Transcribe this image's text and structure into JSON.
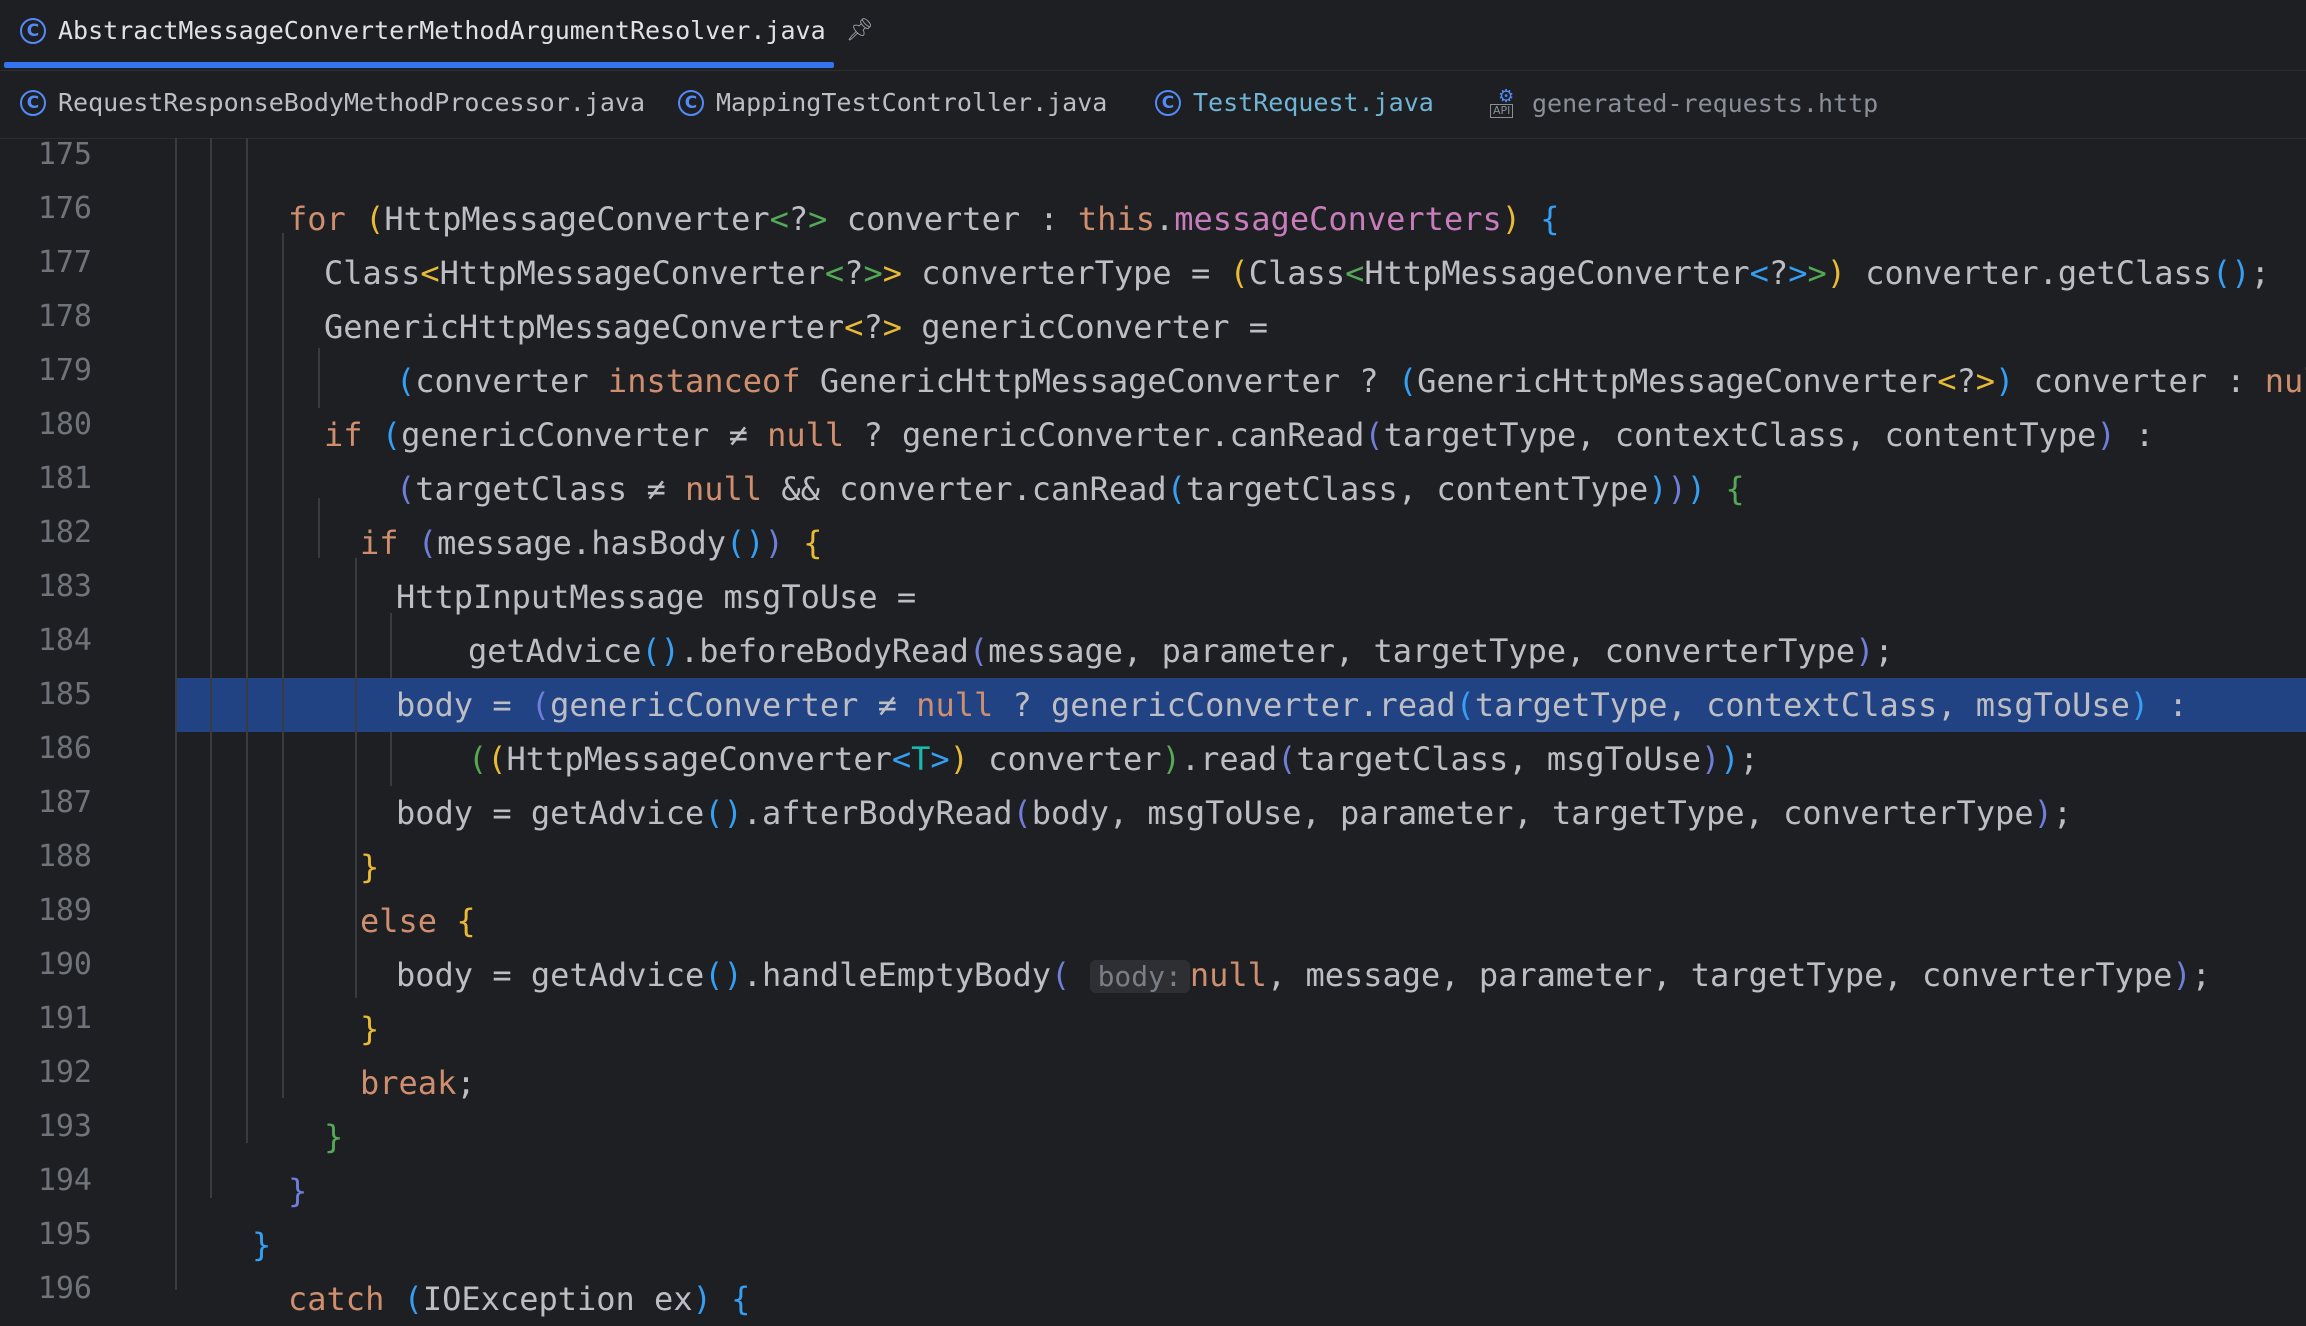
{
  "editor": {
    "active_tab": {
      "label": "AbstractMessageConverterMethodArgumentResolver.java",
      "icon": "class-icon"
    },
    "tabs": [
      {
        "label": "RequestResponseBodyMethodProcessor.java",
        "icon": "class-icon",
        "color": "#bcbec4"
      },
      {
        "label": "MappingTestController.java",
        "icon": "class-icon",
        "color": "#bcbec4"
      },
      {
        "label": "TestRequest.java",
        "icon": "class-icon",
        "color": "#6fb5d6"
      },
      {
        "label": "generated-requests.http",
        "icon": "api-file-icon",
        "color": "#8a8f98"
      }
    ],
    "line_numbers": [
      "175",
      "176",
      "177",
      "178",
      "179",
      "180",
      "181",
      "182",
      "183",
      "184",
      "185",
      "186",
      "187",
      "188",
      "189",
      "190",
      "191",
      "192",
      "193",
      "194",
      "195",
      "196"
    ],
    "highlighted_line": "185",
    "inlay_hint": "body:"
  },
  "theme": {
    "background": "#1e1f22",
    "selection": "#214283",
    "tab_underline": "#3574f0"
  }
}
